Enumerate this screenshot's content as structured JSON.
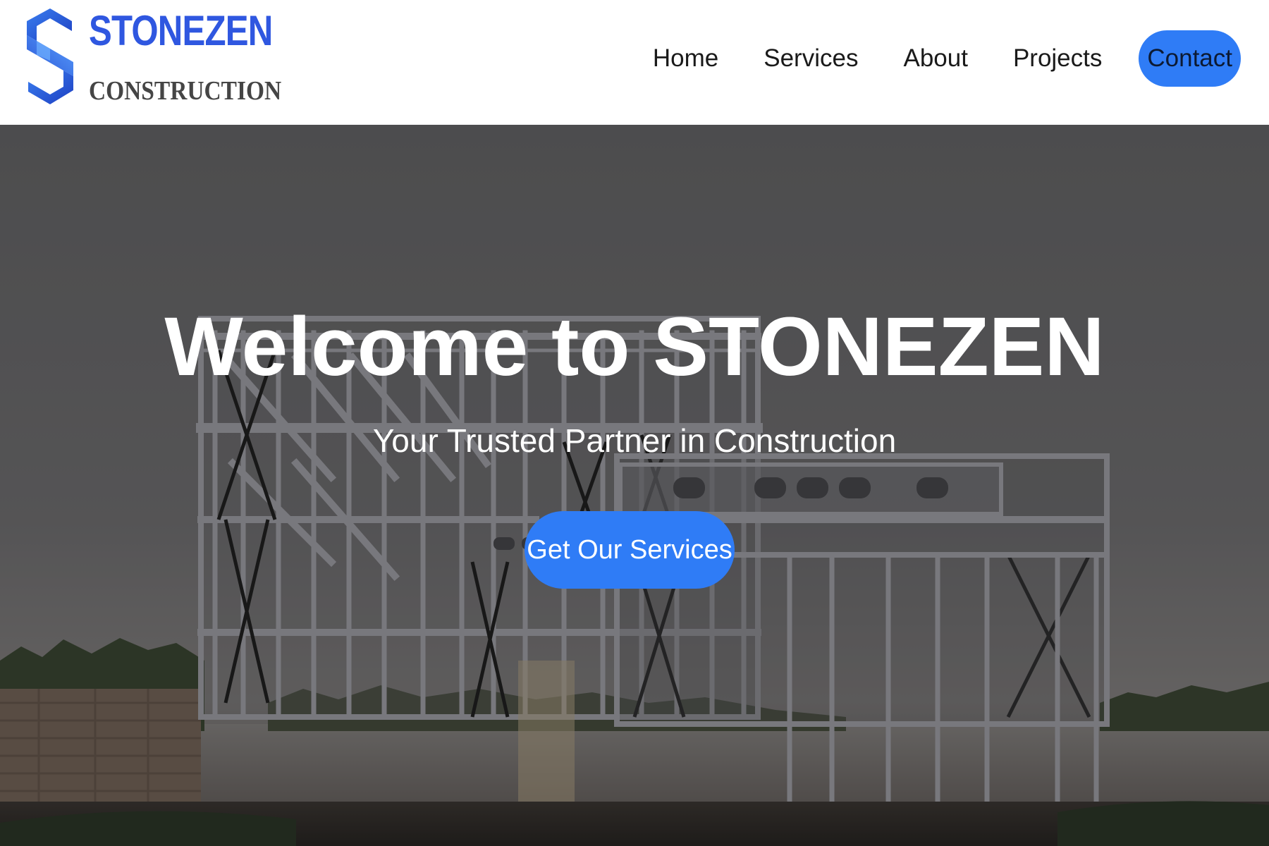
{
  "brand": {
    "name": "STONEZEN",
    "tagline": "CONSTRUCTION",
    "colors": {
      "primary": "#2f57e0",
      "secondary": "#454545"
    }
  },
  "nav": {
    "items": [
      "Home",
      "Services",
      "About",
      "Projects"
    ],
    "contact": "Contact"
  },
  "hero": {
    "title": "Welcome to STONEZEN",
    "subtitle": "Your Trusted Partner in Construction",
    "cta": "Get Our Services",
    "background": "steel-frame-house-photo"
  },
  "colors": {
    "accent": "#2f7cf6",
    "header_bg": "#ffffff",
    "hero_overlay": "#000000"
  }
}
